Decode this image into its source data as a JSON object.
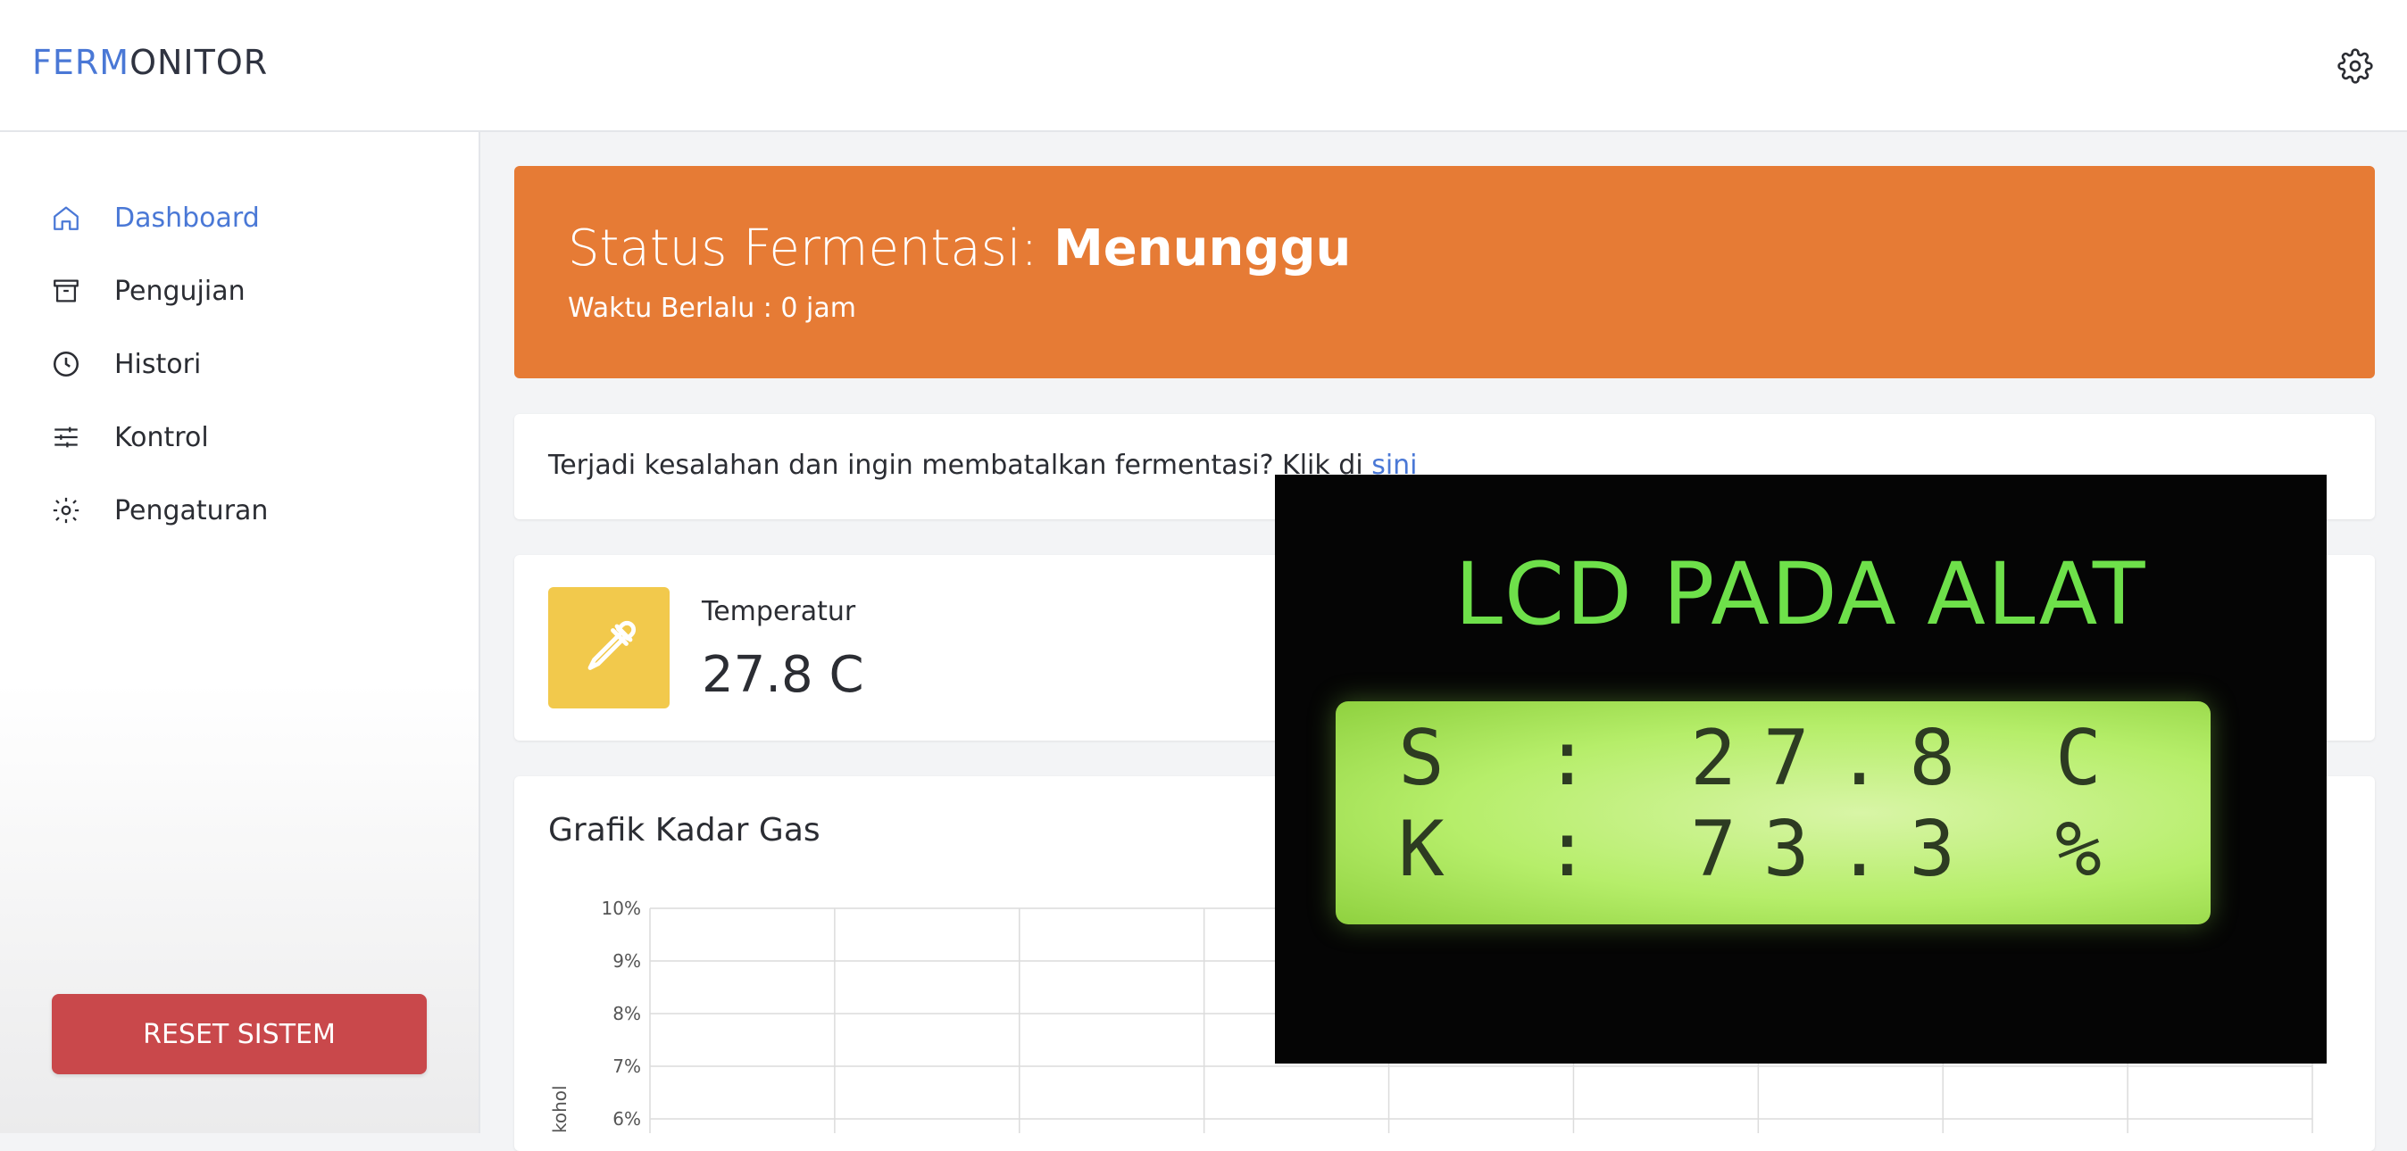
{
  "header": {
    "logo_accent": "FERM",
    "logo_rest": "ONITOR",
    "settings_icon": "gear-icon"
  },
  "sidebar": {
    "items": [
      {
        "label": "Dashboard",
        "icon": "home-icon",
        "active": true
      },
      {
        "label": "Pengujian",
        "icon": "archive-icon",
        "active": false
      },
      {
        "label": "Histori",
        "icon": "clock-icon",
        "active": false
      },
      {
        "label": "Kontrol",
        "icon": "sliders-icon",
        "active": false
      },
      {
        "label": "Pengaturan",
        "icon": "gear-icon",
        "active": false
      }
    ],
    "reset_label": "RESET SISTEM"
  },
  "status": {
    "prefix": "Status Fermentasi: ",
    "value": "Menunggu",
    "elapsed": "Waktu Berlalu : 0 jam",
    "color": "#e67b35"
  },
  "cancel": {
    "text": "Terjadi kesalahan dan ingin membatalkan fermentasi? Klik di ",
    "link": "sini"
  },
  "temperature": {
    "label": "Temperatur",
    "value": "27.8 C",
    "icon": "dropper-icon"
  },
  "chart": {
    "title": "Grafik Kadar Gas",
    "ylabel_partial": "kohol"
  },
  "chart_data": {
    "type": "line",
    "title": "Grafik Kadar Gas",
    "ylabel": "kohol",
    "y_ticks": [
      "10%",
      "9%",
      "8%",
      "7%",
      "6%"
    ],
    "ylim": [
      6,
      10
    ],
    "grid": true,
    "series": []
  },
  "lcd": {
    "title": "LCD PADA ALAT",
    "row1": "S : 27.8 C",
    "row2": "K : 73.3 %"
  }
}
